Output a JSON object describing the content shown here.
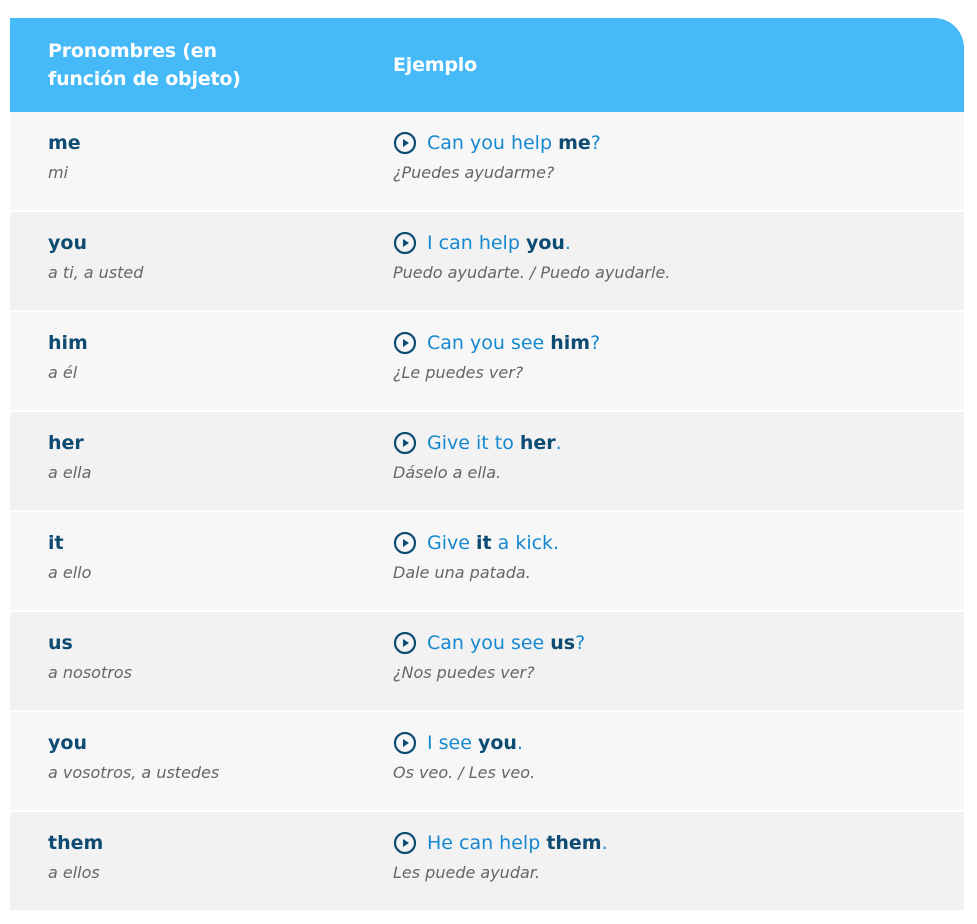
{
  "header": {
    "col1_line1": "Pronombres (en",
    "col1_line2": "función de objeto)",
    "col2": "Ejemplo"
  },
  "rows": [
    {
      "pronoun": "me",
      "translation": "mi",
      "example": {
        "pre": "Can you help ",
        "bold": "me",
        "post": "?"
      },
      "example_translation": "¿Puedes ayudarme?"
    },
    {
      "pronoun": "you",
      "translation": "a ti, a usted",
      "example": {
        "pre": "I can help ",
        "bold": "you",
        "post": "."
      },
      "example_translation": "Puedo ayudarte. / Puedo ayudarle."
    },
    {
      "pronoun": "him",
      "translation": "a él",
      "example": {
        "pre": "Can you see ",
        "bold": "him",
        "post": "?"
      },
      "example_translation": "¿Le puedes ver?"
    },
    {
      "pronoun": "her",
      "translation": "a ella",
      "example": {
        "pre": "Give it to ",
        "bold": "her",
        "post": "."
      },
      "example_translation": "Dáselo a ella."
    },
    {
      "pronoun": "it",
      "translation": "a ello",
      "example": {
        "pre": "Give ",
        "bold": "it",
        "post": " a kick."
      },
      "example_translation": "Dale una patada."
    },
    {
      "pronoun": "us",
      "translation": "a nosotros",
      "example": {
        "pre": "Can you see ",
        "bold": "us",
        "post": "?"
      },
      "example_translation": "¿Nos puedes ver?"
    },
    {
      "pronoun": "you",
      "translation": "a vosotros, a ustedes",
      "example": {
        "pre": "I see ",
        "bold": "you",
        "post": "."
      },
      "example_translation": "Os veo. / Les veo."
    },
    {
      "pronoun": "them",
      "translation": "a ellos",
      "example": {
        "pre": "He can help ",
        "bold": "them",
        "post": "."
      },
      "example_translation": "Les puede ayudar."
    }
  ],
  "colors": {
    "header_bg": "#46baf8",
    "pronoun": "#0d4b73",
    "example_link": "#1588cf",
    "translation": "#666666"
  },
  "icons": {
    "play": "play-circle-icon"
  }
}
